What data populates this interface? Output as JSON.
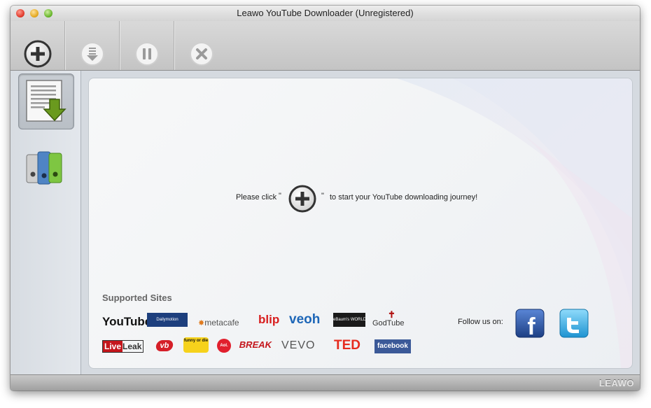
{
  "window": {
    "title": "Leawo YouTube Downloader (Unregistered)"
  },
  "toolbar": {
    "buttons": [
      {
        "name": "add-url-button",
        "icon": "plus-icon"
      },
      {
        "name": "download-button",
        "icon": "download-icon"
      },
      {
        "name": "pause-button",
        "icon": "pause-icon"
      },
      {
        "name": "cancel-button",
        "icon": "close-icon"
      }
    ]
  },
  "sidebar": {
    "items": [
      {
        "name": "downloading",
        "icon": "download-document-icon",
        "active": true
      },
      {
        "name": "library",
        "icon": "library-binders-icon",
        "active": false
      }
    ]
  },
  "main": {
    "prompt_before": "Please click",
    "quote_open": "\"",
    "quote_close": "\"",
    "prompt_after": "to start your YouTube downloading journey!",
    "supported_title": "Supported Sites",
    "follow_label": "Follow us on:"
  },
  "sites": {
    "youtube": "YouTube",
    "dailymotion": "Dailymotion",
    "metacafe": "metacafe",
    "blip": "blip",
    "veoh": "veoh",
    "ebaumsworld": "eBaum's WORLD",
    "godtube": "GodTube",
    "liveleak_live": "Live",
    "liveleak_leak": "Leak",
    "vb": "vb",
    "funnyordie": "funny or die",
    "aol": "Aol.",
    "break": "BREAK",
    "vevo": "VEVO",
    "ted": "TED",
    "facebook": "facebook"
  },
  "social": {
    "facebook": "f"
  },
  "status": {
    "brand": "LEAWO"
  },
  "colors": {
    "youtube_red": "#cc181e",
    "ted_red": "#e62b1e",
    "facebook_blue": "#3b5998",
    "twitter_blue": "#2ab2e8"
  }
}
